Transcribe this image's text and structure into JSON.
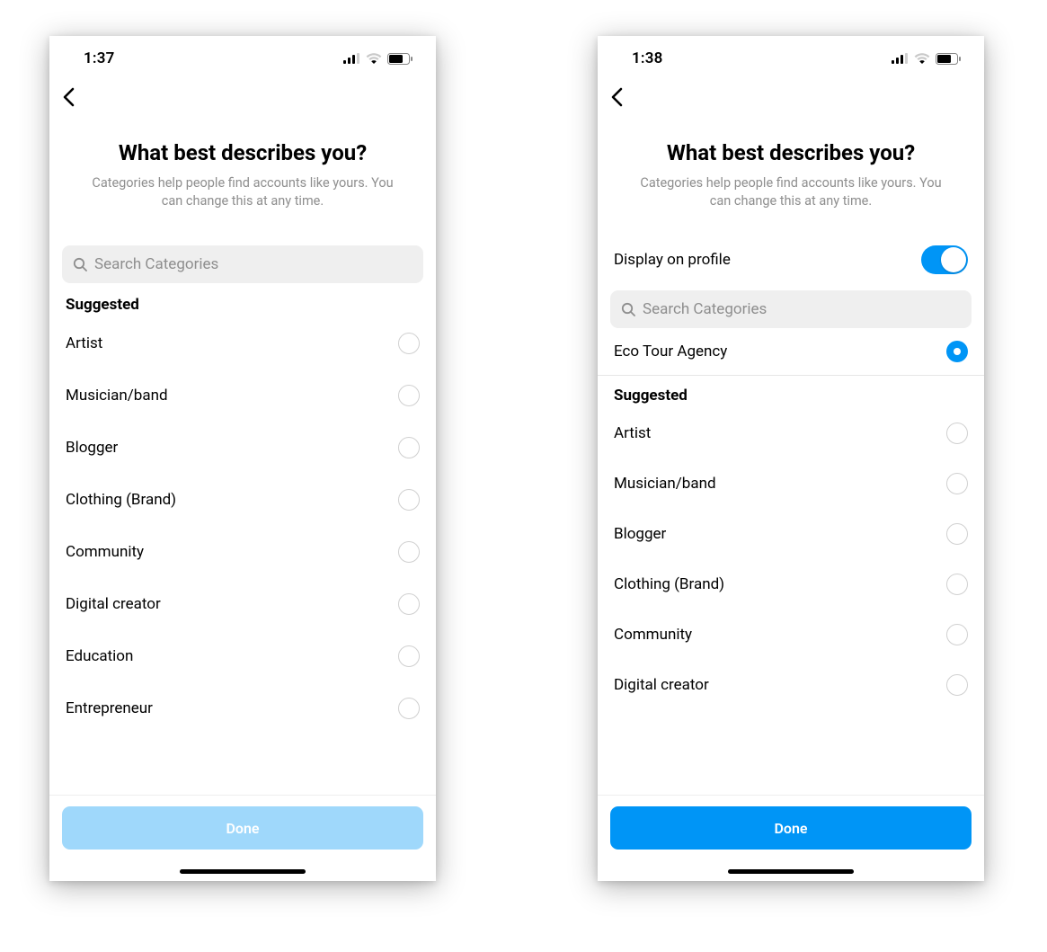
{
  "left": {
    "status_time": "1:37",
    "title": "What best describes you?",
    "subtitle": "Categories help people find accounts like yours. You can change this at any time.",
    "search_placeholder": "Search Categories",
    "suggested_heading": "Suggested",
    "done_label": "Done",
    "done_enabled": false,
    "items": [
      {
        "label": "Artist"
      },
      {
        "label": "Musician/band"
      },
      {
        "label": "Blogger"
      },
      {
        "label": "Clothing (Brand)"
      },
      {
        "label": "Community"
      },
      {
        "label": "Digital creator"
      },
      {
        "label": "Education"
      },
      {
        "label": "Entrepreneur"
      }
    ]
  },
  "right": {
    "status_time": "1:38",
    "title": "What best describes you?",
    "subtitle": "Categories help people find accounts like yours. You can change this at any time.",
    "display_on_profile_label": "Display on profile",
    "display_on_profile_value": true,
    "search_placeholder": "Search Categories",
    "selected_category": "Eco Tour Agency",
    "suggested_heading": "Suggested",
    "done_label": "Done",
    "done_enabled": true,
    "items": [
      {
        "label": "Artist"
      },
      {
        "label": "Musician/band"
      },
      {
        "label": "Blogger"
      },
      {
        "label": "Clothing (Brand)"
      },
      {
        "label": "Community"
      },
      {
        "label": "Digital creator"
      }
    ]
  }
}
